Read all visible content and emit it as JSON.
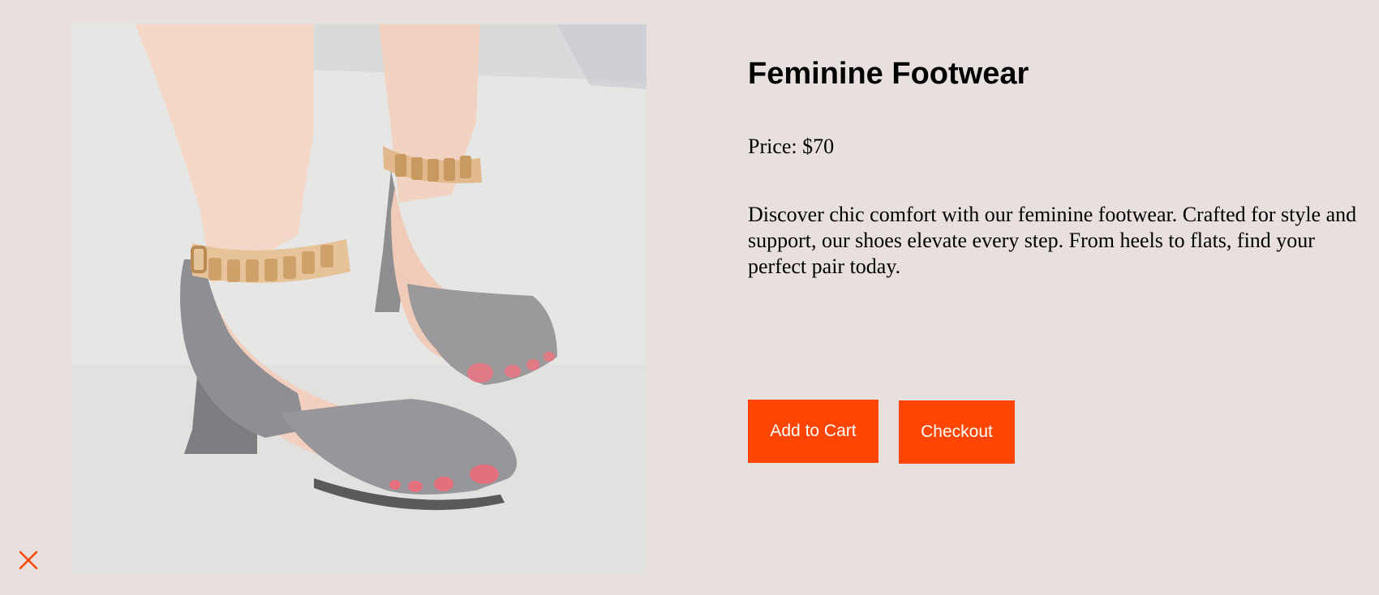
{
  "product": {
    "title": "Feminine Footwear",
    "price": "Price: $70",
    "description": "Discover chic comfort with our feminine footwear. Crafted for style and support, our shoes elevate every step. From heels to flats, find your perfect pair today.",
    "image_icon": "product-photo"
  },
  "actions": {
    "add_to_cart_label": "Add to Cart",
    "checkout_label": "Checkout"
  },
  "controls": {
    "close_icon": "close-icon"
  },
  "colors": {
    "background": "#e8e0df",
    "accent": "#ff4500",
    "button_text": "#ffffff"
  }
}
